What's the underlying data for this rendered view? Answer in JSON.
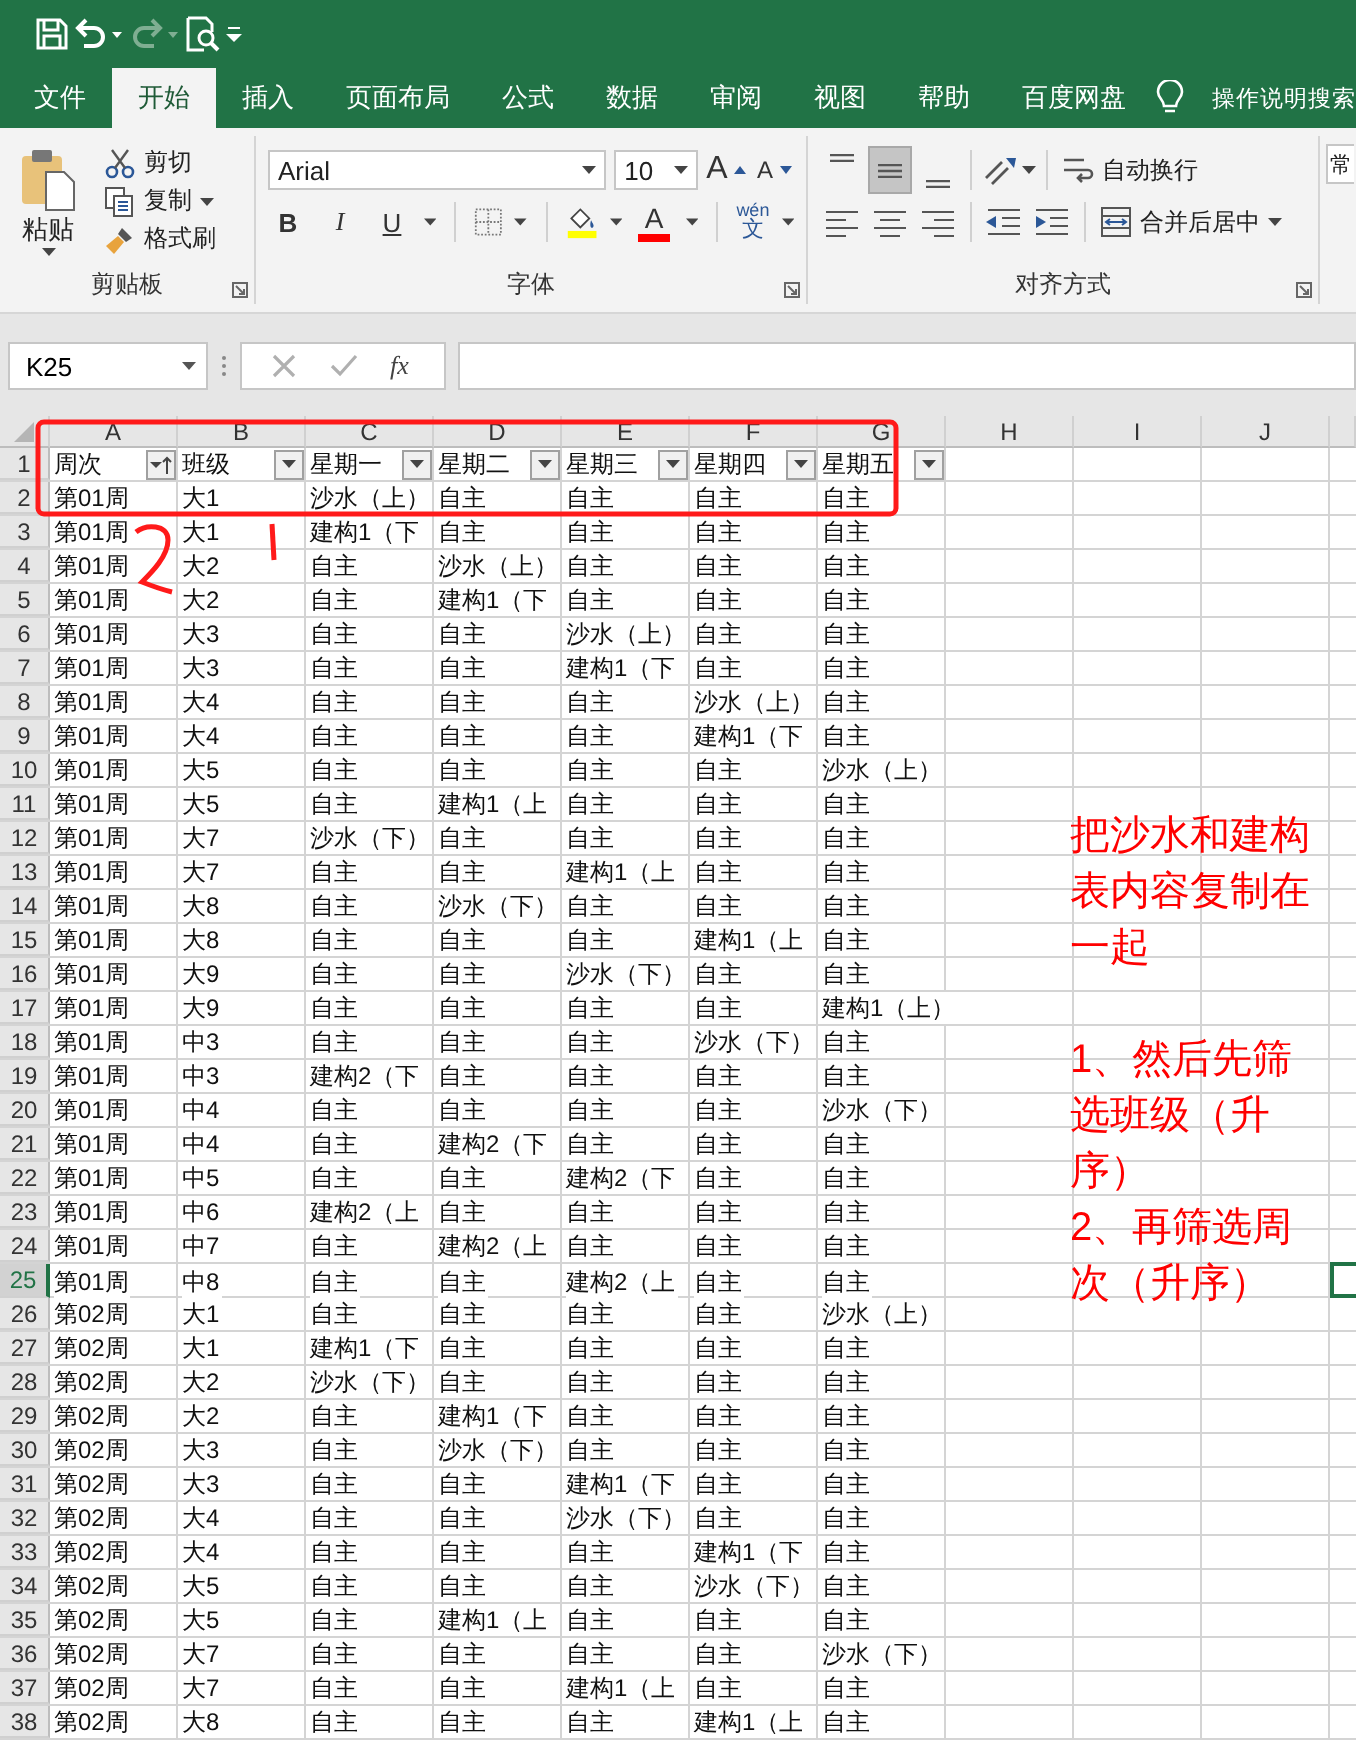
{
  "quick_access": [
    {
      "kind": "save",
      "disabled": false
    },
    {
      "kind": "undo",
      "disabled": false
    },
    {
      "kind": "redo",
      "disabled": true
    },
    {
      "kind": "preview",
      "disabled": false
    },
    {
      "kind": "customize",
      "disabled": false
    }
  ],
  "tabs": [
    {
      "label": "文件",
      "selected": false
    },
    {
      "label": "开始",
      "selected": true
    },
    {
      "label": "插入",
      "selected": false
    },
    {
      "label": "页面布局",
      "selected": false
    },
    {
      "label": "公式",
      "selected": false
    },
    {
      "label": "数据",
      "selected": false
    },
    {
      "label": "审阅",
      "selected": false
    },
    {
      "label": "视图",
      "selected": false
    },
    {
      "label": "帮助",
      "selected": false
    },
    {
      "label": "百度网盘",
      "selected": false
    }
  ],
  "search_hint": "操作说明搜索",
  "ribbon": {
    "clipboard": {
      "title": "剪贴板",
      "paste": "粘贴",
      "items": [
        {
          "kind": "cut",
          "label": "剪切"
        },
        {
          "kind": "copy",
          "label": "复制"
        },
        {
          "kind": "brush",
          "label": "格式刷"
        }
      ]
    },
    "font": {
      "title": "字体",
      "font_name": "Arial",
      "font_size": "10",
      "size_buttons": [
        "A",
        "A"
      ],
      "styles": [
        "B",
        "I",
        "U"
      ],
      "font_color_label": "A",
      "phonetic": [
        "wén",
        "文"
      ]
    },
    "alignment": {
      "title": "对齐方式",
      "vertical": [
        {
          "kind": "top",
          "selected": false
        },
        {
          "kind": "middle",
          "selected": true
        },
        {
          "kind": "bottom",
          "selected": false
        }
      ],
      "wrap": "自动换行",
      "merge": "合并后居中"
    },
    "number": {
      "format": "常"
    }
  },
  "formula_bar": {
    "name_box": "K25",
    "buttons": [
      {
        "kind": "cancel",
        "disabled": true
      },
      {
        "kind": "enter",
        "disabled": true
      }
    ],
    "function_label": "fx"
  },
  "sheet": {
    "columns": [
      "A",
      "B",
      "C",
      "D",
      "E",
      "F",
      "G",
      "H",
      "I",
      "J"
    ],
    "header": {
      "n": "1",
      "cells": [
        {
          "text": "周次",
          "sorted": true
        },
        {
          "text": "班级",
          "sorted": false
        },
        {
          "text": "星期一",
          "sorted": false
        },
        {
          "text": "星期二",
          "sorted": false
        },
        {
          "text": "星期三",
          "sorted": false
        },
        {
          "text": "星期四",
          "sorted": false
        },
        {
          "text": "星期五",
          "sorted": false
        }
      ]
    },
    "rows": [
      {
        "n": "2",
        "selected": false,
        "cells": [
          "第01周",
          "大1",
          "沙水（上）",
          "自主",
          "自主",
          "自主",
          "自主"
        ]
      },
      {
        "n": "3",
        "selected": false,
        "cells": [
          "第01周",
          "大1",
          "建构1（下",
          "自主",
          "自主",
          "自主",
          "自主"
        ]
      },
      {
        "n": "4",
        "selected": false,
        "cells": [
          "第01周",
          "大2",
          "自主",
          "沙水（上）",
          "自主",
          "自主",
          "自主"
        ]
      },
      {
        "n": "5",
        "selected": false,
        "cells": [
          "第01周",
          "大2",
          "自主",
          "建构1（下",
          "自主",
          "自主",
          "自主"
        ]
      },
      {
        "n": "6",
        "selected": false,
        "cells": [
          "第01周",
          "大3",
          "自主",
          "自主",
          "沙水（上）",
          "自主",
          "自主"
        ]
      },
      {
        "n": "7",
        "selected": false,
        "cells": [
          "第01周",
          "大3",
          "自主",
          "自主",
          "建构1（下",
          "自主",
          "自主"
        ]
      },
      {
        "n": "8",
        "selected": false,
        "cells": [
          "第01周",
          "大4",
          "自主",
          "自主",
          "自主",
          "沙水（上）",
          "自主"
        ]
      },
      {
        "n": "9",
        "selected": false,
        "cells": [
          "第01周",
          "大4",
          "自主",
          "自主",
          "自主",
          "建构1（下",
          "自主"
        ]
      },
      {
        "n": "10",
        "selected": false,
        "cells": [
          "第01周",
          "大5",
          "自主",
          "自主",
          "自主",
          "自主",
          "沙水（上）"
        ]
      },
      {
        "n": "11",
        "selected": false,
        "cells": [
          "第01周",
          "大5",
          "自主",
          "建构1（上",
          "自主",
          "自主",
          "自主"
        ]
      },
      {
        "n": "12",
        "selected": false,
        "cells": [
          "第01周",
          "大7",
          "沙水（下）",
          "自主",
          "自主",
          "自主",
          "自主"
        ]
      },
      {
        "n": "13",
        "selected": false,
        "cells": [
          "第01周",
          "大7",
          "自主",
          "自主",
          "建构1（上",
          "自主",
          "自主"
        ]
      },
      {
        "n": "14",
        "selected": false,
        "cells": [
          "第01周",
          "大8",
          "自主",
          "沙水（下）",
          "自主",
          "自主",
          "自主"
        ]
      },
      {
        "n": "15",
        "selected": false,
        "cells": [
          "第01周",
          "大8",
          "自主",
          "自主",
          "自主",
          "建构1（上",
          "自主"
        ]
      },
      {
        "n": "16",
        "selected": false,
        "cells": [
          "第01周",
          "大9",
          "自主",
          "自主",
          "沙水（下）",
          "自主",
          "自主"
        ]
      },
      {
        "n": "17",
        "selected": false,
        "cells": [
          "第01周",
          "大9",
          "自主",
          "自主",
          "自主",
          "自主",
          "建构1（上）"
        ]
      },
      {
        "n": "18",
        "selected": false,
        "cells": [
          "第01周",
          "中3",
          "自主",
          "自主",
          "自主",
          "沙水（下）",
          "自主"
        ]
      },
      {
        "n": "19",
        "selected": false,
        "cells": [
          "第01周",
          "中3",
          "建构2（下",
          "自主",
          "自主",
          "自主",
          "自主"
        ]
      },
      {
        "n": "20",
        "selected": false,
        "cells": [
          "第01周",
          "中4",
          "自主",
          "自主",
          "自主",
          "自主",
          "沙水（下）"
        ]
      },
      {
        "n": "21",
        "selected": false,
        "cells": [
          "第01周",
          "中4",
          "自主",
          "建构2（下",
          "自主",
          "自主",
          "自主"
        ]
      },
      {
        "n": "22",
        "selected": false,
        "cells": [
          "第01周",
          "中5",
          "自主",
          "自主",
          "建构2（下",
          "自主",
          "自主"
        ]
      },
      {
        "n": "23",
        "selected": false,
        "cells": [
          "第01周",
          "中6",
          "建构2（上",
          "自主",
          "自主",
          "自主",
          "自主"
        ]
      },
      {
        "n": "24",
        "selected": false,
        "cells": [
          "第01周",
          "中7",
          "自主",
          "建构2（上",
          "自主",
          "自主",
          "自主"
        ]
      },
      {
        "n": "25",
        "selected": true,
        "cells": [
          "第01周",
          "中8",
          "自主",
          "自主",
          "建构2（上",
          "自主",
          "自主"
        ]
      },
      {
        "n": "26",
        "selected": false,
        "cells": [
          "第02周",
          "大1",
          "自主",
          "自主",
          "自主",
          "自主",
          "沙水（上）"
        ]
      },
      {
        "n": "27",
        "selected": false,
        "cells": [
          "第02周",
          "大1",
          "建构1（下",
          "自主",
          "自主",
          "自主",
          "自主"
        ]
      },
      {
        "n": "28",
        "selected": false,
        "cells": [
          "第02周",
          "大2",
          "沙水（下）",
          "自主",
          "自主",
          "自主",
          "自主"
        ]
      },
      {
        "n": "29",
        "selected": false,
        "cells": [
          "第02周",
          "大2",
          "自主",
          "建构1（下",
          "自主",
          "自主",
          "自主"
        ]
      },
      {
        "n": "30",
        "selected": false,
        "cells": [
          "第02周",
          "大3",
          "自主",
          "沙水（下）",
          "自主",
          "自主",
          "自主"
        ]
      },
      {
        "n": "31",
        "selected": false,
        "cells": [
          "第02周",
          "大3",
          "自主",
          "自主",
          "建构1（下",
          "自主",
          "自主"
        ]
      },
      {
        "n": "32",
        "selected": false,
        "cells": [
          "第02周",
          "大4",
          "自主",
          "自主",
          "沙水（下）",
          "自主",
          "自主"
        ]
      },
      {
        "n": "33",
        "selected": false,
        "cells": [
          "第02周",
          "大4",
          "自主",
          "自主",
          "自主",
          "建构1（下",
          "自主"
        ]
      },
      {
        "n": "34",
        "selected": false,
        "cells": [
          "第02周",
          "大5",
          "自主",
          "自主",
          "自主",
          "沙水（下）",
          "自主"
        ]
      },
      {
        "n": "35",
        "selected": false,
        "cells": [
          "第02周",
          "大5",
          "自主",
          "建构1（上",
          "自主",
          "自主",
          "自主"
        ]
      },
      {
        "n": "36",
        "selected": false,
        "cells": [
          "第02周",
          "大7",
          "自主",
          "自主",
          "自主",
          "自主",
          "沙水（下）"
        ]
      },
      {
        "n": "37",
        "selected": false,
        "cells": [
          "第02周",
          "大7",
          "自主",
          "自主",
          "建构1（上",
          "自主",
          "自主"
        ]
      },
      {
        "n": "38",
        "selected": false,
        "cells": [
          "第02周",
          "大8",
          "自主",
          "自主",
          "自主",
          "建构1（上",
          "自主"
        ]
      }
    ]
  },
  "note": {
    "paragraphs": [
      "把沙水和建构表内容复制在一起",
      "1、然后先筛选班级（升序）",
      "2、再筛选周次（升序）"
    ]
  }
}
